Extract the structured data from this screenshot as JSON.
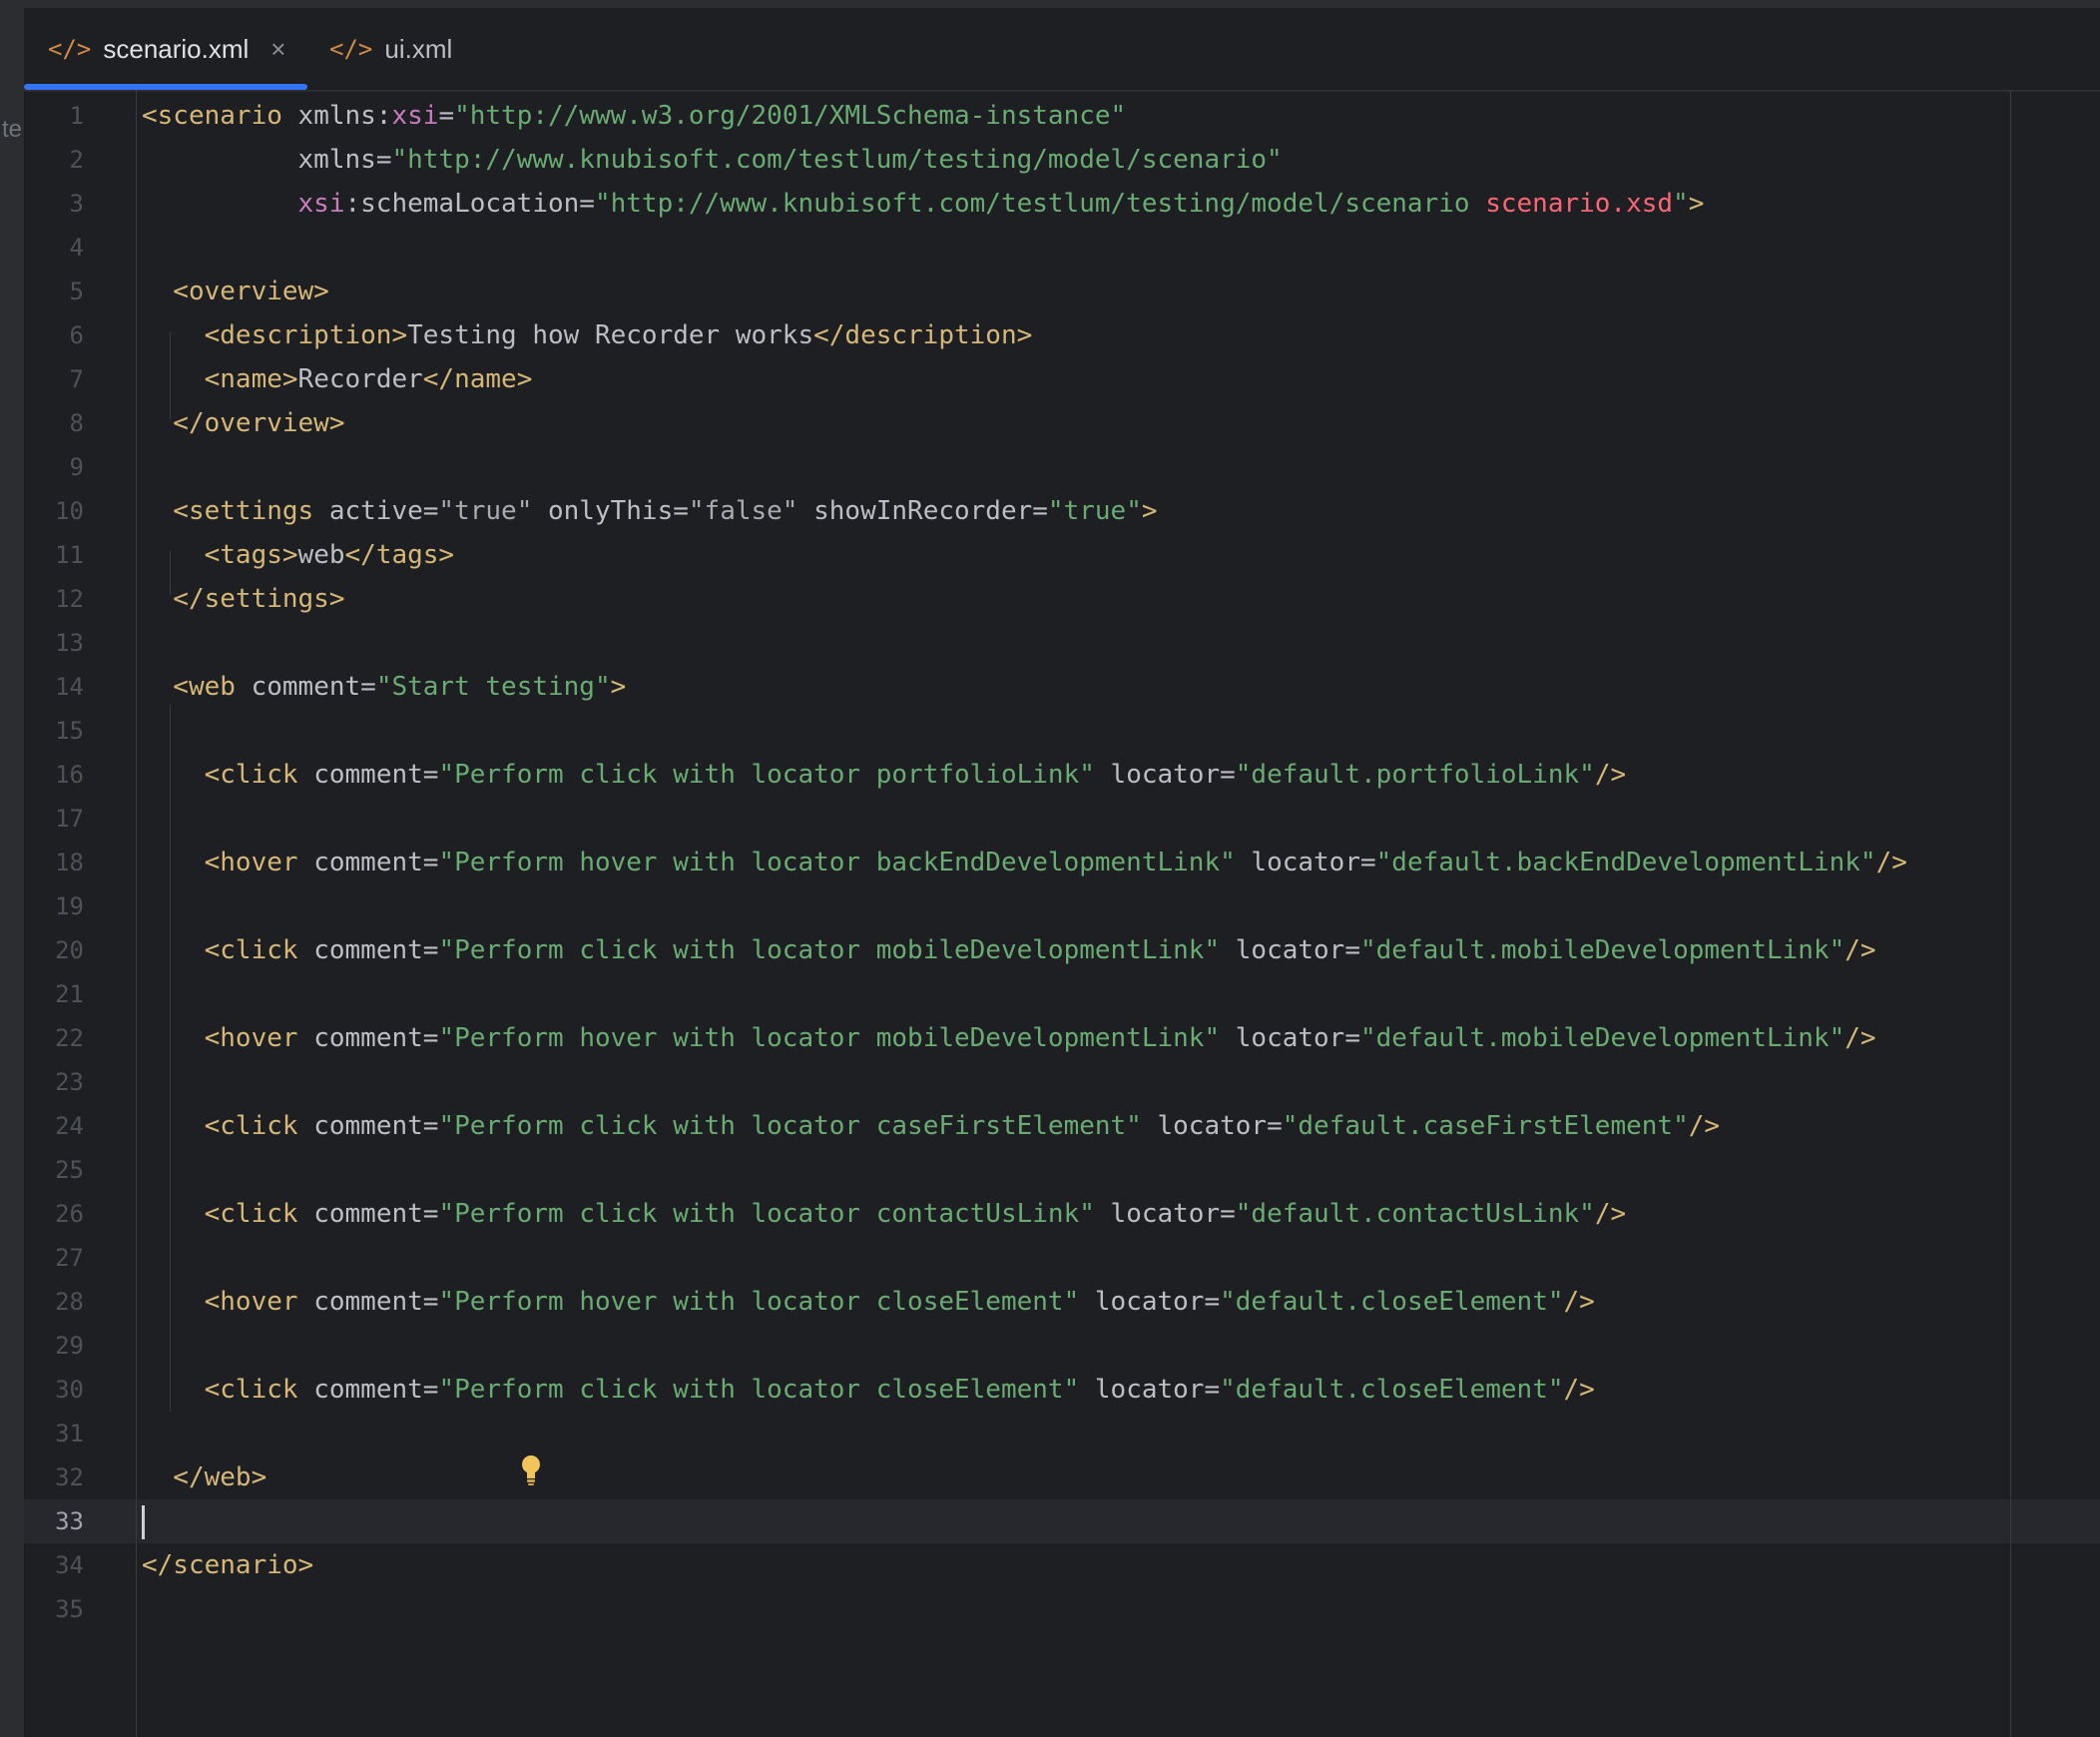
{
  "tabs": [
    {
      "label": "scenario.xml",
      "icon": "code-tag-icon",
      "active": true,
      "close": "×"
    },
    {
      "label": "ui.xml",
      "icon": "code-tag-icon",
      "active": false
    }
  ],
  "tab_icon_glyph": "</>",
  "clipped_left_text": "te",
  "current_line": 33,
  "colors": {
    "tag": "#d5b778",
    "attr": "#bcbec4",
    "namespace": "#c77dbb",
    "value": "#6aab73",
    "error": "#fa6675",
    "accent": "#3574f0",
    "background": "#1e1f22"
  },
  "lines": [
    [
      [
        "t",
        "<scenario"
      ],
      [
        "a",
        " xmlns:"
      ],
      [
        "ns",
        "xsi"
      ],
      [
        "a",
        "="
      ],
      [
        "v",
        "\"http://www.w3.org/2001/XMLSchema-instance\""
      ]
    ],
    [
      [
        "a",
        "          xmlns"
      ],
      [
        "a",
        "="
      ],
      [
        "v",
        "\"http://www.knubisoft.com/testlum/testing/model/scenario\""
      ]
    ],
    [
      [
        "ns",
        "          xsi"
      ],
      [
        "a",
        ":schemaLocation="
      ],
      [
        "v",
        "\"http://www.knubisoft.com/testlum/testing/model/scenario "
      ],
      [
        "err",
        "scenario.xsd"
      ],
      [
        "v",
        "\""
      ],
      [
        "t",
        ">"
      ]
    ],
    [],
    [
      [
        "t",
        "  <overview>"
      ]
    ],
    [
      [
        "t",
        "    <description>"
      ],
      [
        "a",
        "Testing how Recorder works"
      ],
      [
        "t",
        "</description>"
      ]
    ],
    [
      [
        "t",
        "    <name>"
      ],
      [
        "a",
        "Recorder"
      ],
      [
        "t",
        "</name>"
      ]
    ],
    [
      [
        "t",
        "  </overview>"
      ]
    ],
    [],
    [
      [
        "t",
        "  <settings"
      ],
      [
        "a",
        " active="
      ],
      [
        "bool",
        "\"true\""
      ],
      [
        "a",
        " onlyThis="
      ],
      [
        "bool",
        "\"false\""
      ],
      [
        "a",
        " showInRecorder="
      ],
      [
        "v",
        "\"true\""
      ],
      [
        "t",
        ">"
      ]
    ],
    [
      [
        "t",
        "    <tags>"
      ],
      [
        "a",
        "web"
      ],
      [
        "t",
        "</tags>"
      ]
    ],
    [
      [
        "t",
        "  </settings>"
      ]
    ],
    [],
    [
      [
        "t",
        "  <web"
      ],
      [
        "a",
        " comment="
      ],
      [
        "v",
        "\"Start testing\""
      ],
      [
        "t",
        ">"
      ]
    ],
    [],
    [
      [
        "t",
        "    <click"
      ],
      [
        "a",
        " comment="
      ],
      [
        "v",
        "\"Perform click with locator portfolioLink\""
      ],
      [
        "a",
        " locator="
      ],
      [
        "v",
        "\"default.portfolioLink\""
      ],
      [
        "t",
        "/>"
      ]
    ],
    [],
    [
      [
        "t",
        "    <hover"
      ],
      [
        "a",
        " comment="
      ],
      [
        "v",
        "\"Perform hover with locator backEndDevelopmentLink\""
      ],
      [
        "a",
        " locator="
      ],
      [
        "v",
        "\"default.backEndDevelopmentLink\""
      ],
      [
        "t",
        "/>"
      ]
    ],
    [],
    [
      [
        "t",
        "    <click"
      ],
      [
        "a",
        " comment="
      ],
      [
        "v",
        "\"Perform click with locator mobileDevelopmentLink\""
      ],
      [
        "a",
        " locator="
      ],
      [
        "v",
        "\"default.mobileDevelopmentLink\""
      ],
      [
        "t",
        "/>"
      ]
    ],
    [],
    [
      [
        "t",
        "    <hover"
      ],
      [
        "a",
        " comment="
      ],
      [
        "v",
        "\"Perform hover with locator mobileDevelopmentLink\""
      ],
      [
        "a",
        " locator="
      ],
      [
        "v",
        "\"default.mobileDevelopmentLink\""
      ],
      [
        "t",
        "/>"
      ]
    ],
    [],
    [
      [
        "t",
        "    <click"
      ],
      [
        "a",
        " comment="
      ],
      [
        "v",
        "\"Perform click with locator caseFirstElement\""
      ],
      [
        "a",
        " locator="
      ],
      [
        "v",
        "\"default.caseFirstElement\""
      ],
      [
        "t",
        "/>"
      ]
    ],
    [],
    [
      [
        "t",
        "    <click"
      ],
      [
        "a",
        " comment="
      ],
      [
        "v",
        "\"Perform click with locator contactUsLink\""
      ],
      [
        "a",
        " locator="
      ],
      [
        "v",
        "\"default.contactUsLink\""
      ],
      [
        "t",
        "/>"
      ]
    ],
    [],
    [
      [
        "t",
        "    <hover"
      ],
      [
        "a",
        " comment="
      ],
      [
        "v",
        "\"Perform hover with locator closeElement\""
      ],
      [
        "a",
        " locator="
      ],
      [
        "v",
        "\"default.closeElement\""
      ],
      [
        "t",
        "/>"
      ]
    ],
    [],
    [
      [
        "t",
        "    <click"
      ],
      [
        "a",
        " comment="
      ],
      [
        "v",
        "\"Perform click with locator closeElement\""
      ],
      [
        "a",
        " locator="
      ],
      [
        "v",
        "\"default.closeElement\""
      ],
      [
        "t",
        "/>"
      ]
    ],
    [],
    [
      [
        "t",
        "  </web>"
      ]
    ],
    [],
    [
      [
        "t",
        "</scenario>"
      ]
    ],
    []
  ]
}
